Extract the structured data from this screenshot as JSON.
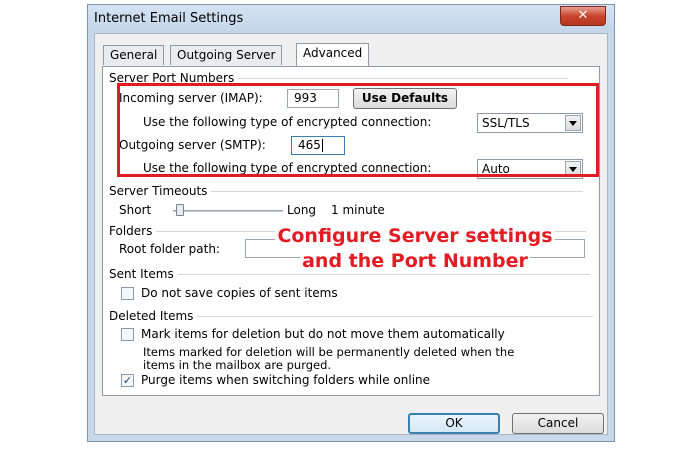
{
  "window": {
    "title": "Internet Email Settings",
    "close_symbol": "✕"
  },
  "tabs": [
    {
      "label": "General",
      "active": false
    },
    {
      "label": "Outgoing Server",
      "active": false
    },
    {
      "label": "Advanced",
      "active": true
    }
  ],
  "server_ports": {
    "heading": "Server Port Numbers",
    "incoming_label": "Incoming server (IMAP):",
    "incoming_value": "993",
    "use_defaults_label": "Use Defaults",
    "incoming_encryption_label": "Use the following type of encrypted connection:",
    "incoming_encryption_value": "SSL/TLS",
    "outgoing_label": "Outgoing server (SMTP):",
    "outgoing_value": "465",
    "outgoing_encryption_label": "Use the following type of encrypted connection:",
    "outgoing_encryption_value": "Auto"
  },
  "timeouts": {
    "heading": "Server Timeouts",
    "short_label": "Short",
    "long_label": "Long",
    "value": "1 minute",
    "slider_level": 0.06
  },
  "folders": {
    "heading": "Folders",
    "root_label": "Root folder path:",
    "root_value": ""
  },
  "sent_items": {
    "heading": "Sent Items",
    "no_copies_label": "Do not save copies of sent items",
    "no_copies_checked": false
  },
  "deleted_items": {
    "heading": "Deleted Items",
    "mark_label": "Mark items for deletion but do not move them automatically",
    "mark_checked": false,
    "note_line1": "Items marked for deletion will be permanently deleted when the",
    "note_line2": "items in the mailbox are purged.",
    "purge_label": "Purge items when switching folders while online",
    "purge_checked": true,
    "check_symbol": "✓"
  },
  "footer": {
    "ok_label": "OK",
    "cancel_label": "Cancel"
  },
  "annotation": {
    "line1": "Configure Server settings",
    "line2": "and the Port Number",
    "color": "#e31b23"
  },
  "colors": {
    "title_bar": "#c8d8ea",
    "close_button": "#c8452c",
    "focus_border": "#3c7fb1"
  }
}
